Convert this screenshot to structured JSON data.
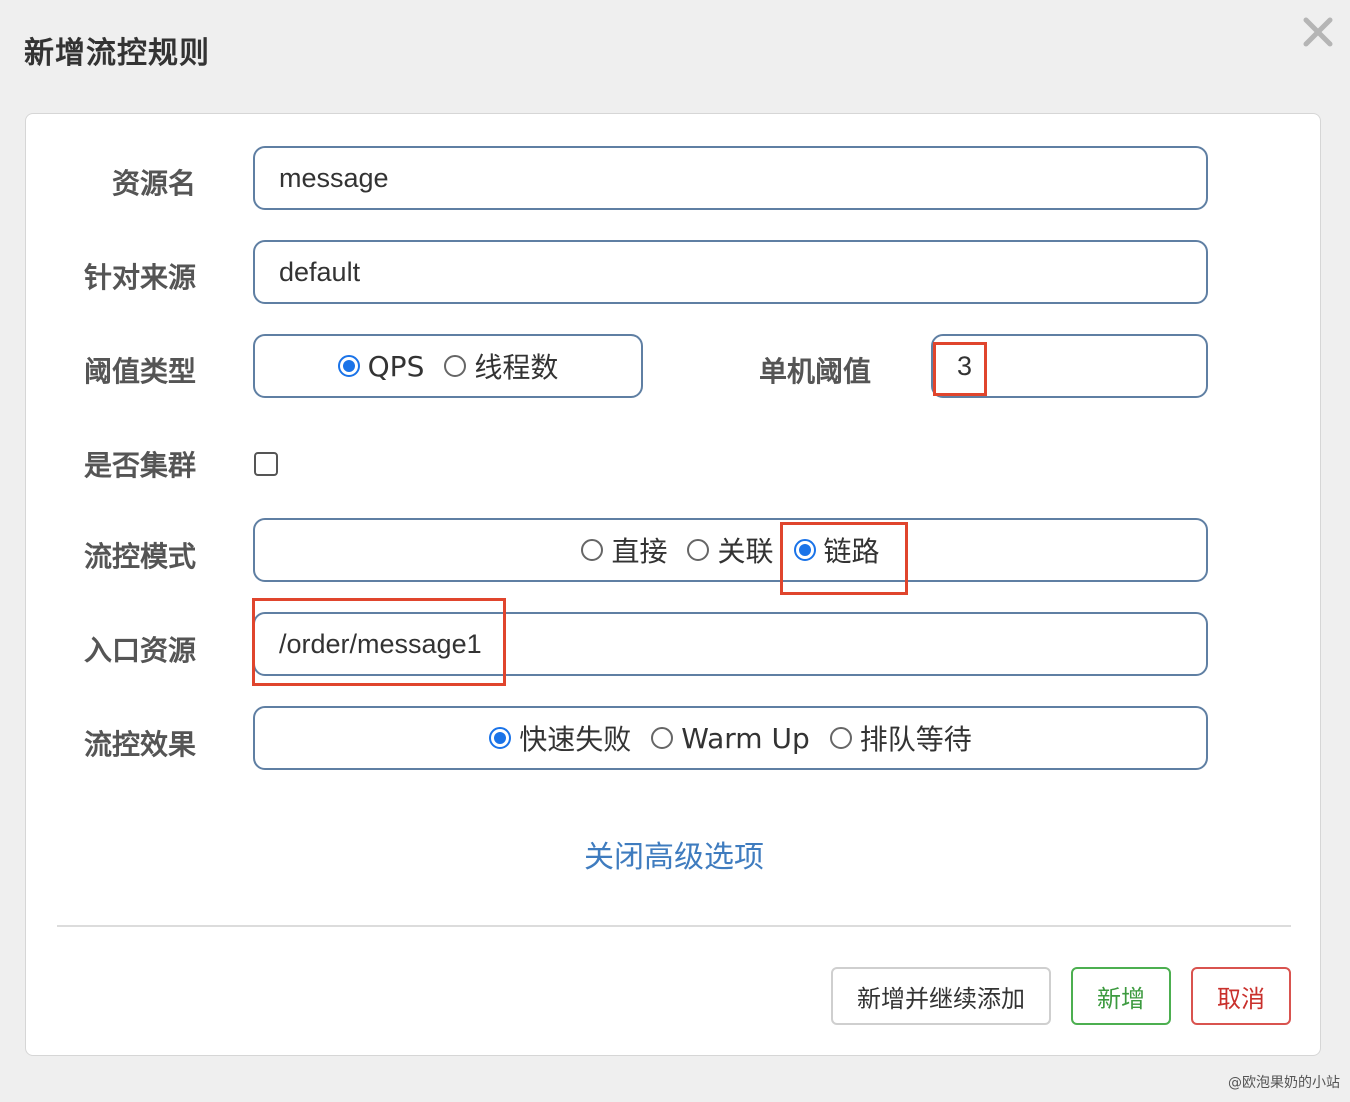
{
  "dialog": {
    "title": "新增流控规则"
  },
  "form": {
    "resource_name": {
      "label": "资源名",
      "value": "message"
    },
    "limit_app": {
      "label": "针对来源",
      "value": "default"
    },
    "grade": {
      "label": "阈值类型",
      "options": [
        "QPS",
        "线程数"
      ],
      "selected": "QPS"
    },
    "count": {
      "label": "单机阈值",
      "value": "3"
    },
    "cluster": {
      "label": "是否集群",
      "checked": false
    },
    "strategy": {
      "label": "流控模式",
      "options": [
        "直接",
        "关联",
        "链路"
      ],
      "selected": "链路"
    },
    "ref_resource": {
      "label": "入口资源",
      "value": "/order/message1"
    },
    "control_behavior": {
      "label": "流控效果",
      "options": [
        "快速失败",
        "Warm Up",
        "排队等待"
      ],
      "selected": "快速失败"
    },
    "advanced_toggle": "关闭高级选项"
  },
  "footer": {
    "add_continue_label": "新增并继续添加",
    "add_label": "新增",
    "cancel_label": "取消"
  },
  "watermark": "@欧泡果奶的小站",
  "colors": {
    "accent": "#1a73e8",
    "highlight": "#e0452d",
    "field_border": "#5f7fa3",
    "link": "#3f7cbf",
    "success": "#4caf50",
    "danger": "#d9534f"
  },
  "icons": {
    "close": "close-icon"
  }
}
